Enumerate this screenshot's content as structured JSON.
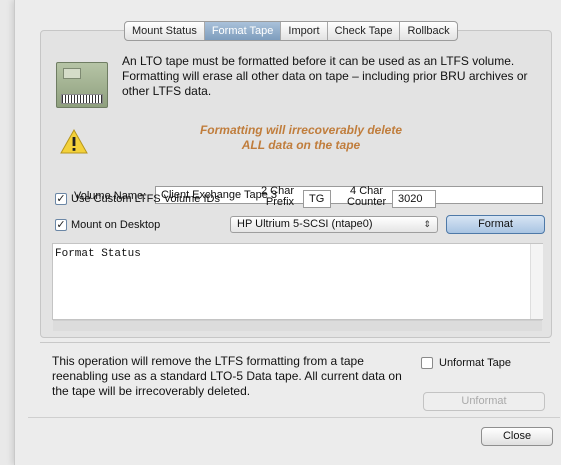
{
  "tabs": [
    {
      "label": "Mount Status",
      "active": false
    },
    {
      "label": "Format Tape",
      "active": true
    },
    {
      "label": "Import",
      "active": false
    },
    {
      "label": "Check Tape",
      "active": false
    },
    {
      "label": "Rollback",
      "active": false
    }
  ],
  "description": "An LTO tape must be formatted before it can be used as an LTFS volume.  Formatting will erase all other data on tape – including prior BRU archives or other LTFS data.",
  "warning": {
    "line1": "Formatting will irrecoverably delete",
    "line2": "ALL data on the tape"
  },
  "volume_name": {
    "label": "Volume Name:",
    "value": "Client Exchange Tape 3"
  },
  "custom_ids": {
    "label": "Use Custom LTFS Volume IDs",
    "checked": true,
    "prefix_label_line1": "2 Char",
    "prefix_label_line2": "Prefix",
    "prefix_value": "TG",
    "counter_label_line1": "4 Char",
    "counter_label_line2": "Counter",
    "counter_value": "3020"
  },
  "mount_on_desktop": {
    "label": "Mount on Desktop",
    "checked": true
  },
  "device_select": {
    "selected": "HP Ultrium 5-SCSI (ntape0)"
  },
  "format_button": "Format",
  "format_status": "Format Status",
  "unformat": {
    "description": "This operation will remove the LTFS formatting from a tape reenabling use as a standard LTO-5 Data tape. All current data on the tape will be irrecoverably deleted.",
    "checkbox_label": "Unformat Tape",
    "button": "Unformat"
  },
  "close_button": "Close",
  "colors": {
    "warning_text": "#c07d3c",
    "active_tab": "#8aa7c6",
    "warning_icon": "#f3d13a"
  }
}
